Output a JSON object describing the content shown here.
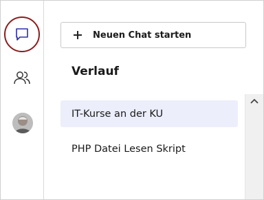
{
  "sidebar": {
    "items": [
      {
        "name": "chat",
        "icon": "chat-bubble-icon",
        "active": true
      },
      {
        "name": "users",
        "icon": "users-icon",
        "active": false
      }
    ],
    "accent_color": "#8b1d1d"
  },
  "main": {
    "new_chat_label": "Neuen Chat starten",
    "history_heading": "Verlauf",
    "history_items": [
      {
        "label": "IT-Kurse an der KU",
        "selected": true
      },
      {
        "label": "PHP Datei Lesen Skript",
        "selected": false
      }
    ],
    "selected_bg": "#eceefb"
  }
}
